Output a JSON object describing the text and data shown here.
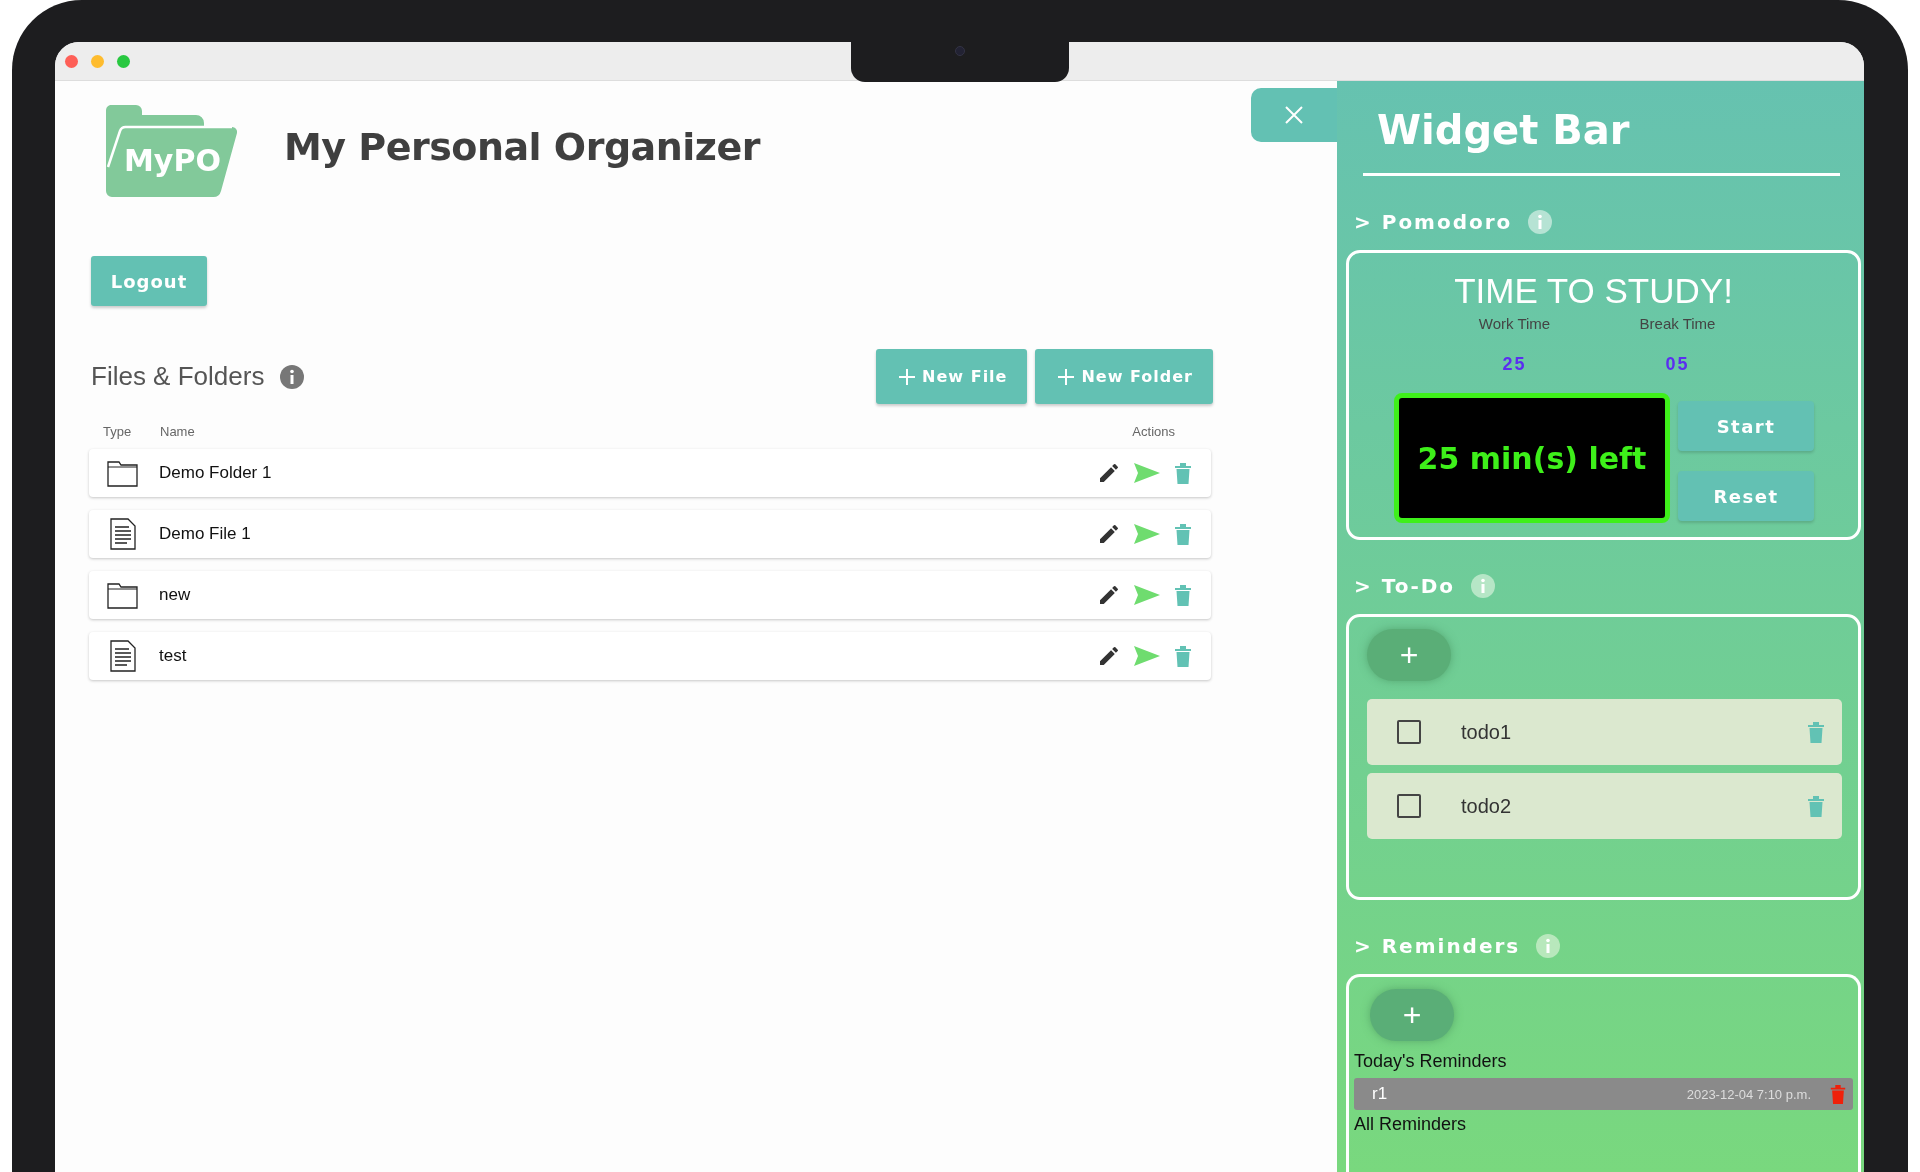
{
  "app": {
    "logo_text": "MyPO",
    "title": "My Personal Organizer"
  },
  "logout_button": "Logout",
  "files": {
    "heading": "Files & Folders",
    "buttons": [
      "New File",
      "New Folder"
    ],
    "columns": [
      "Type",
      "Name",
      "Actions"
    ],
    "rows": [
      {
        "kind": "folder",
        "name": "Demo Folder 1"
      },
      {
        "kind": "file",
        "name": "Demo File 1"
      },
      {
        "kind": "folder",
        "name": "new"
      },
      {
        "kind": "file",
        "name": "test"
      }
    ]
  },
  "widget_bar": {
    "title": "Widget Bar",
    "pomodoro": {
      "heading": "> Pomodoro",
      "title": "TIME TO STUDY!",
      "work_label": "Work Time",
      "break_label": "Break Time",
      "work_value": "25",
      "break_value": "05",
      "display": "25 min(s) left",
      "buttons": [
        "Start",
        "Reset"
      ]
    },
    "todo": {
      "heading": "> To-Do",
      "add": "+",
      "items": [
        {
          "text": "todo1",
          "checked": false
        },
        {
          "text": "todo2",
          "checked": false
        }
      ]
    },
    "reminders": {
      "heading": "> Reminders",
      "add": "+",
      "today_label": "Today's Reminders",
      "today": [
        {
          "name": "r1",
          "datetime": "2023-12-04 7:10 p.m."
        }
      ],
      "all_label": "All Reminders"
    }
  }
}
